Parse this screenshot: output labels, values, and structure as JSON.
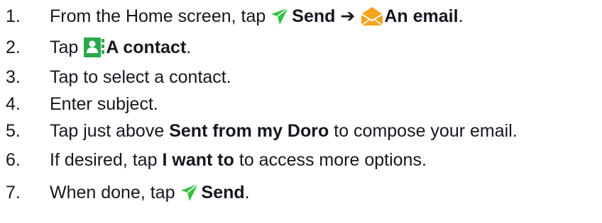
{
  "steps": [
    {
      "number": "1.",
      "parts": {
        "a": "From the Home screen, tap",
        "b": "Send",
        "c": "➔",
        "d": "An email",
        "e": "."
      },
      "icons": [
        "send-icon",
        "email-icon"
      ]
    },
    {
      "number": "2.",
      "parts": {
        "a": "Tap",
        "b": "A contact",
        "c": "."
      },
      "icons": [
        "contact-icon"
      ]
    },
    {
      "number": "3.",
      "parts": {
        "a": "Tap to select a contact."
      }
    },
    {
      "number": "4.",
      "parts": {
        "a": "Enter subject."
      }
    },
    {
      "number": "5.",
      "parts": {
        "a": "Tap just above",
        "b": "Sent from my Doro",
        "c": "to compose your email."
      }
    },
    {
      "number": "6.",
      "parts": {
        "a": "If desired, tap",
        "b": "I want to",
        "c": "to access more options."
      }
    },
    {
      "number": "7.",
      "parts": {
        "a": "When done, tap",
        "b": "Send",
        "c": "."
      },
      "icons": [
        "send-icon"
      ]
    }
  ],
  "colors": {
    "text": "#14181f",
    "send_icon": "#34c241",
    "email_icon": "#f5a21c",
    "contact_icon": "#2ba84a"
  }
}
